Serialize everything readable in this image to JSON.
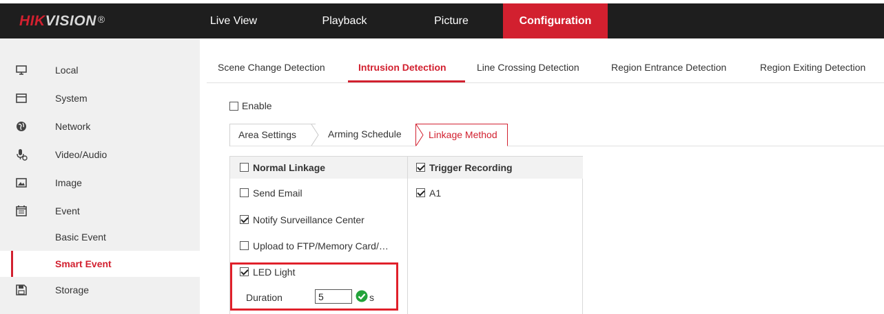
{
  "app": {
    "logo_brand": "HIK",
    "logo_rest": "VISION",
    "logo_mark": "®"
  },
  "topnav": {
    "items": [
      {
        "label": "Live View"
      },
      {
        "label": "Playback"
      },
      {
        "label": "Picture"
      },
      {
        "label": "Configuration",
        "active": true
      }
    ]
  },
  "sidebar": {
    "items": [
      {
        "label": "Local",
        "icon": "monitor-icon"
      },
      {
        "label": "System",
        "icon": "window-icon"
      },
      {
        "label": "Network",
        "icon": "globe-icon"
      },
      {
        "label": "Video/Audio",
        "icon": "microphone-icon"
      },
      {
        "label": "Image",
        "icon": "image-icon"
      },
      {
        "label": "Event",
        "icon": "calendar-icon"
      },
      {
        "label": "Storage",
        "icon": "floppy-icon"
      }
    ],
    "event_subitems": [
      {
        "label": "Basic Event"
      },
      {
        "label": "Smart Event",
        "active": true
      }
    ]
  },
  "tabs": [
    {
      "label": "Scene Change Detection"
    },
    {
      "label": "Intrusion Detection",
      "active": true
    },
    {
      "label": "Line Crossing Detection"
    },
    {
      "label": "Region Entrance Detection"
    },
    {
      "label": "Region Exiting Detection"
    }
  ],
  "enable": {
    "label": "Enable",
    "checked": false
  },
  "subtabs": [
    {
      "label": "Area Settings"
    },
    {
      "label": "Arming Schedule"
    },
    {
      "label": "Linkage Method",
      "active": true
    }
  ],
  "linkage": {
    "normal_header": "Normal Linkage",
    "normal_header_checked": false,
    "normal_items": [
      {
        "label": "Send Email",
        "checked": false
      },
      {
        "label": "Notify Surveillance Center",
        "checked": true
      },
      {
        "label": "Upload to FTP/Memory Card/…",
        "checked": false
      },
      {
        "label": "LED Light",
        "checked": true
      }
    ],
    "duration_label": "Duration",
    "duration_value": "5",
    "duration_unit": "s",
    "trigger_header": "Trigger Recording",
    "trigger_header_checked": true,
    "trigger_items": [
      {
        "label": "A1",
        "checked": true
      }
    ]
  },
  "colors": {
    "accent": "#d2202f",
    "topbar": "#1e1e1e",
    "sidebar": "#f0f0f0",
    "highlight_box": "#e0202a",
    "ok_green": "#22a33a"
  }
}
